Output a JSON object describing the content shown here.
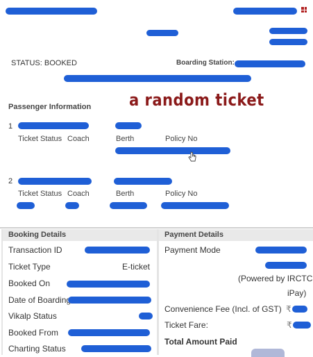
{
  "header": {
    "status_text": "STATUS: BOOKED",
    "boarding_label": "Boarding Station:",
    "menu_icon": "grid-icon"
  },
  "annotation": "a random ticket",
  "passenger_section": {
    "title": "Passenger Information",
    "passengers": [
      {
        "index": "1",
        "labels": [
          "Ticket Status",
          "Coach",
          "Berth",
          "Policy No"
        ]
      },
      {
        "index": "2",
        "labels": [
          "Ticket Status",
          "Coach",
          "Berth",
          "Policy No"
        ]
      }
    ]
  },
  "booking": {
    "title": "Booking Details",
    "rows": [
      {
        "label": "Transaction ID"
      },
      {
        "label": "Ticket Type",
        "value": "E-ticket"
      },
      {
        "label": "Booked On"
      },
      {
        "label": "Date of Boarding"
      },
      {
        "label": "Vikalp Status"
      },
      {
        "label": "Booked From"
      },
      {
        "label": "Charting Status"
      }
    ]
  },
  "payment": {
    "title": "Payment Details",
    "mode_label": "Payment Mode",
    "powered_by": "(Powered by IRCTC",
    "ipay": "iPay)",
    "convenience_label": "Convenience Fee (Incl. of GST)",
    "fare_label": "Ticket Fare:",
    "total_label": "Total Amount Paid",
    "currency_symbol": "₹"
  },
  "colors": {
    "redaction": "#1f5fd6",
    "annotation": "#8b1a1a",
    "panel_header": "#e9e9e9"
  }
}
